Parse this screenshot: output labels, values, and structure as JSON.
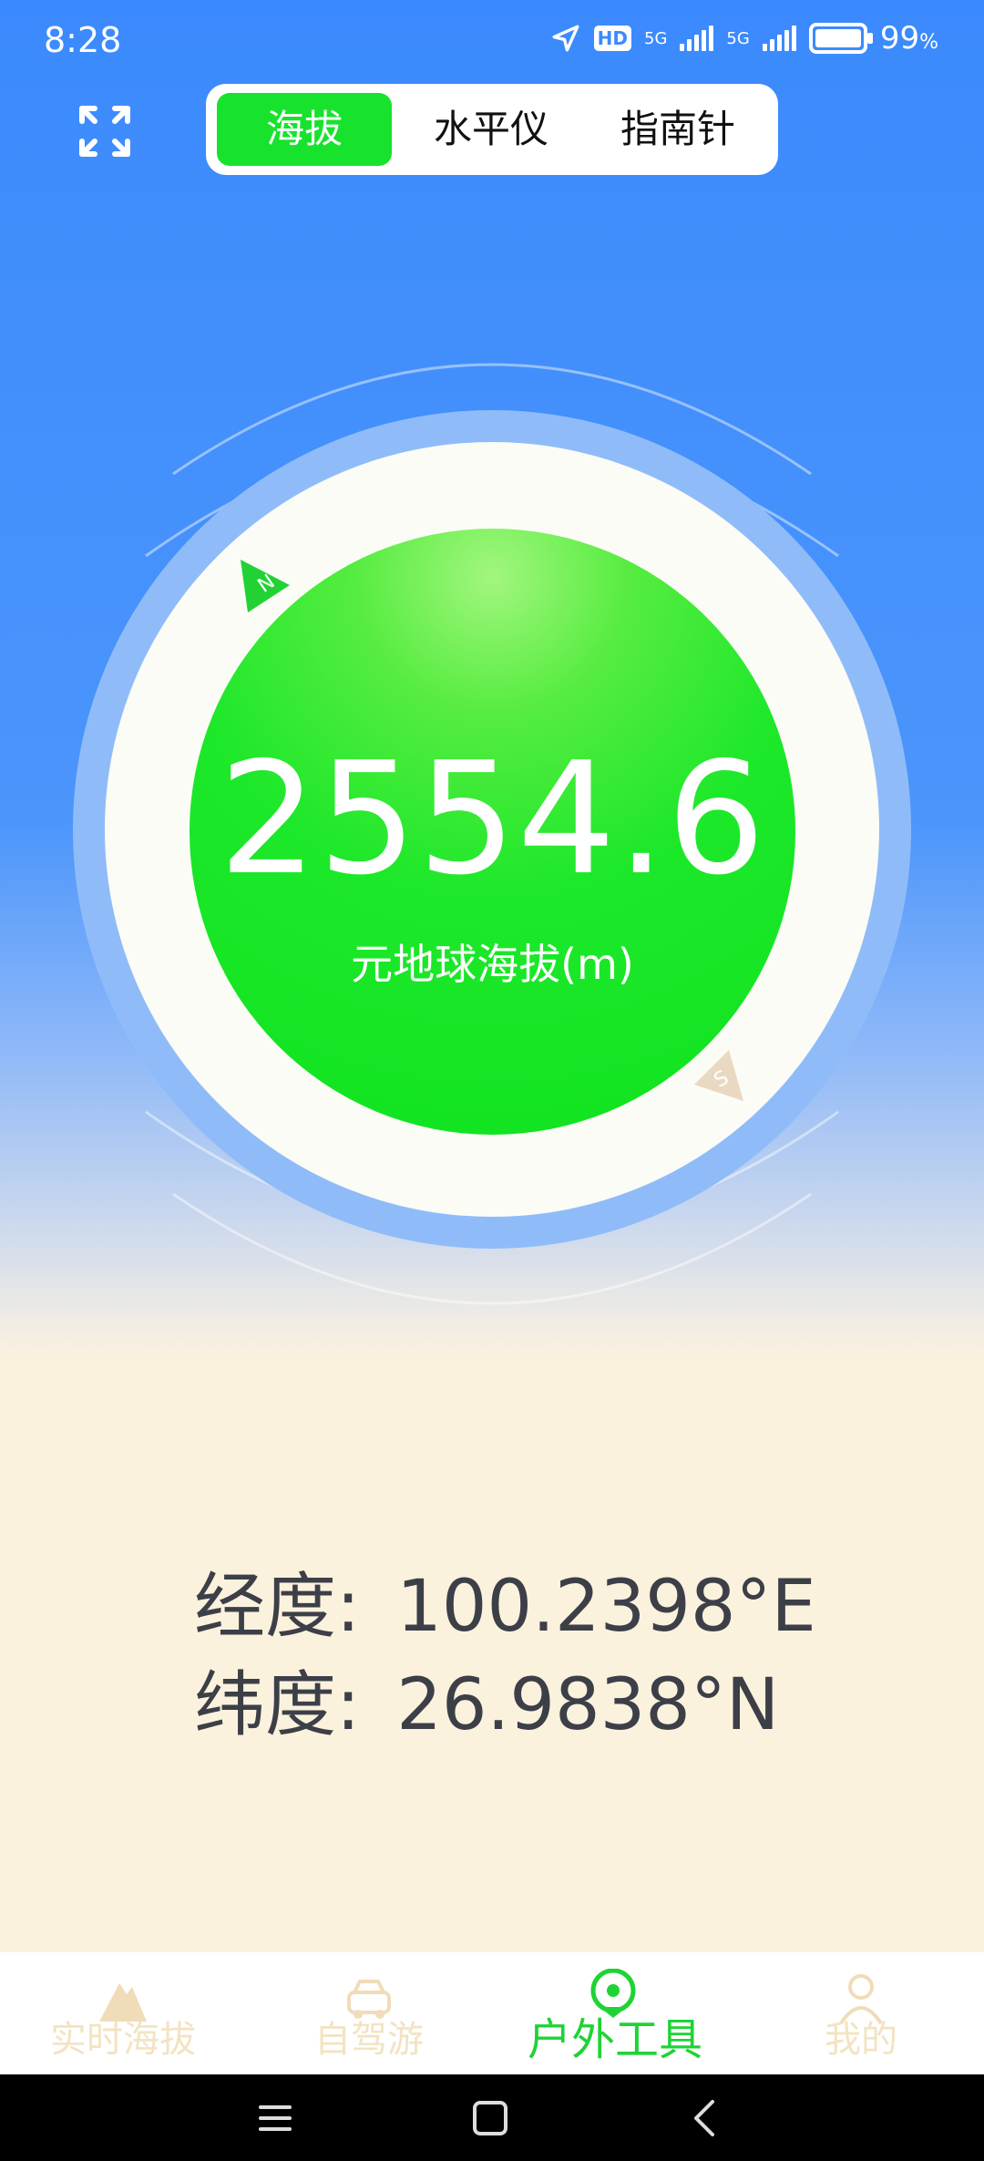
{
  "status_bar": {
    "time": "8:28",
    "hd_badge": "HD",
    "network_1": "5G",
    "network_2": "5G",
    "battery": "99",
    "battery_unit": "%"
  },
  "top": {
    "expand_icon": "expand-icon",
    "segments": [
      {
        "label": "海拔",
        "active": true
      },
      {
        "label": "水平仪",
        "active": false
      },
      {
        "label": "指南针",
        "active": false
      }
    ]
  },
  "gauge": {
    "altitude": "2554.6",
    "label": "元地球海拔(m)",
    "north_marker": "N",
    "south_marker": "S"
  },
  "coordinates": {
    "longitude_label": "经度:",
    "longitude_value": "100.2398°E",
    "latitude_label": "纬度:",
    "latitude_value": "26.9838°N"
  },
  "tabbar": {
    "tabs": [
      {
        "label": "实时海拔",
        "icon": "mountain-icon",
        "active": false
      },
      {
        "label": "自驾游",
        "icon": "car-icon",
        "active": false
      },
      {
        "label": "户外工具",
        "icon": "location-pin-icon",
        "active": true
      },
      {
        "label": "我的",
        "icon": "person-icon",
        "active": false
      }
    ]
  },
  "colors": {
    "accent_green": "#17e32d",
    "background_blue": "#3b8afd"
  }
}
